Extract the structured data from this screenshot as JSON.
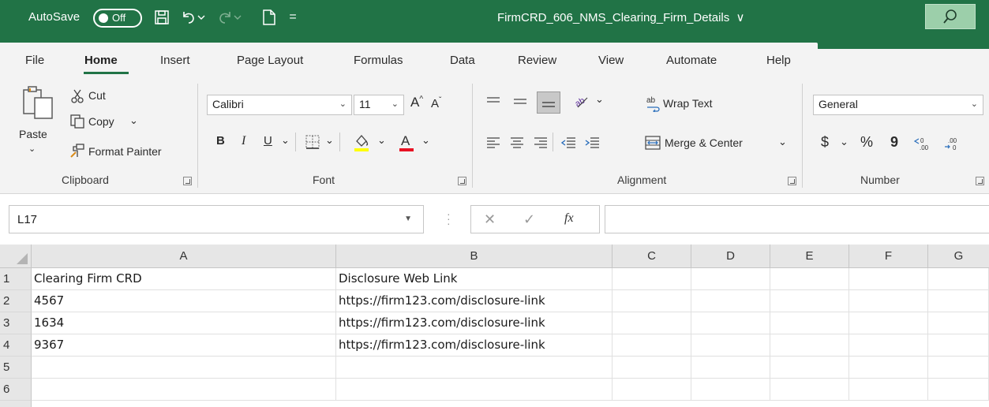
{
  "titlebar": {
    "autosave_label": "AutoSave",
    "autosave_state": "Off",
    "filename": "FirmCRD_606_NMS_Clearing_Firm_Details",
    "filename_caret": "∨",
    "qat_more": "="
  },
  "menu": {
    "tabs": [
      "File",
      "Home",
      "Insert",
      "Page Layout",
      "Formulas",
      "Data",
      "Review",
      "View",
      "Automate",
      "Help"
    ],
    "active": "Home"
  },
  "ribbon": {
    "clipboard": {
      "group_label": "Clipboard",
      "paste": "Paste",
      "cut": "Cut",
      "copy": "Copy",
      "format_painter": "Format Painter"
    },
    "font": {
      "group_label": "Font",
      "font_name": "Calibri",
      "font_size": "11",
      "bold": "B",
      "italic": "I",
      "underline": "U",
      "grow": "A^",
      "shrink": "Aˇ",
      "highlight_color": "#ffff00",
      "font_color": "#ff0000"
    },
    "alignment": {
      "group_label": "Alignment",
      "wrap_text": "Wrap Text",
      "merge_center": "Merge & Center"
    },
    "number": {
      "group_label": "Number",
      "format": "General",
      "currency": "$",
      "percent": "%",
      "comma": "9"
    }
  },
  "formula_bar": {
    "name_box": "L17",
    "fx": "fx",
    "value": ""
  },
  "sheet": {
    "columns": [
      "A",
      "B",
      "C",
      "D",
      "E",
      "F",
      "G"
    ],
    "rows": [
      {
        "num": "1",
        "cells": [
          "Clearing Firm CRD",
          "Disclosure Web Link",
          "",
          "",
          "",
          "",
          ""
        ]
      },
      {
        "num": "2",
        "cells": [
          "4567",
          "https://firm123.com/disclosure-link",
          "",
          "",
          "",
          "",
          ""
        ]
      },
      {
        "num": "3",
        "cells": [
          "1634",
          "https://firm123.com/disclosure-link",
          "",
          "",
          "",
          "",
          ""
        ]
      },
      {
        "num": "4",
        "cells": [
          "9367",
          "https://firm123.com/disclosure-link",
          "",
          "",
          "",
          "",
          ""
        ]
      },
      {
        "num": "5",
        "cells": [
          "",
          "",
          "",
          "",
          "",
          "",
          ""
        ]
      },
      {
        "num": "6",
        "cells": [
          "",
          "",
          "",
          "",
          "",
          "",
          ""
        ]
      }
    ]
  },
  "colors": {
    "title_bar": "#217346",
    "active_tab_underline": "#217346",
    "ribbon_bg": "#f3f3f3"
  }
}
